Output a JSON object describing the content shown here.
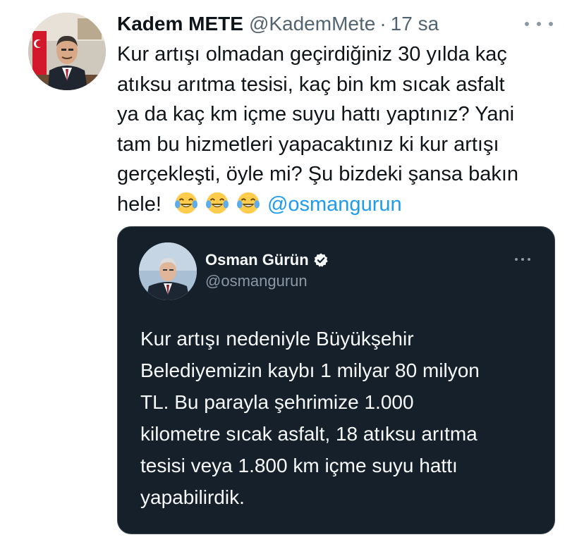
{
  "tweet": {
    "display_name": "Kadem METE",
    "handle": "@KademMete",
    "separator": "·",
    "time": "17 sa",
    "more_icon": "ellipsis-icon",
    "text_lines": [
      "Kur artışı olmadan geçirdiğiniz 30 yılda kaç",
      "atıksu arıtma tesisi, kaç bin km sıcak asfalt",
      "ya da kaç km içme suyu hattı yaptınız? Yani",
      "tam bu hizmetleri yapacaktınız ki kur artışı",
      "gerçekleşti, öyle mi? Şu bizdeki şansa bakın",
      "hele!"
    ],
    "emojis": [
      "face-with-tears-of-joy-icon",
      "face-with-tears-of-joy-icon",
      "face-with-tears-of-joy-icon"
    ],
    "mention": "@osmangurun"
  },
  "quoted_tweet": {
    "display_name": "Osman Gürün",
    "handle": "@osmangurun",
    "verified_icon": "verified-badge-icon",
    "more_icon": "ellipsis-icon",
    "text_lines": [
      "Kur artışı nedeniyle Büyükşehir",
      "Belediyemizin kaybı 1 milyar 80 milyon",
      "TL. Bu parayla şehrimize 1.000",
      "kilometre sıcak asfalt, 18 atıksu arıtma",
      "tesisi veya 1.800 km içme suyu hattı",
      "yapabilirdik."
    ]
  },
  "colors": {
    "background": "#ffffff",
    "text": "#0f1419",
    "secondary_text": "#536471",
    "link": "#1d9bf0",
    "quote_background": "#15202b",
    "quote_text": "#f7f9f9",
    "quote_secondary": "#8b98a5"
  }
}
